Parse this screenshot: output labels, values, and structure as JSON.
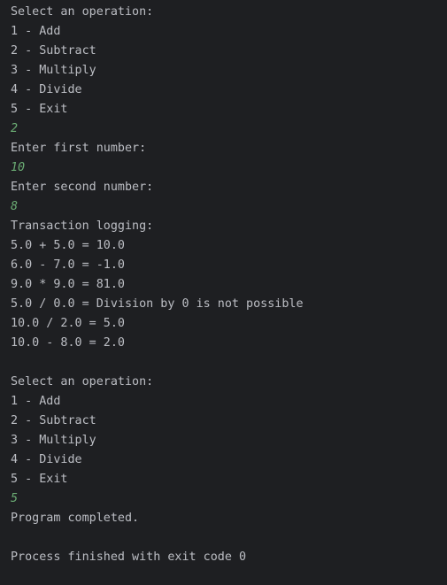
{
  "console": {
    "lines": [
      {
        "text": "Select an operation:",
        "kind": "output"
      },
      {
        "text": "1 - Add",
        "kind": "output"
      },
      {
        "text": "2 - Subtract",
        "kind": "output"
      },
      {
        "text": "3 - Multiply",
        "kind": "output"
      },
      {
        "text": "4 - Divide",
        "kind": "output"
      },
      {
        "text": "5 - Exit",
        "kind": "output"
      },
      {
        "text": "2",
        "kind": "input"
      },
      {
        "text": "Enter first number:",
        "kind": "output"
      },
      {
        "text": "10",
        "kind": "input"
      },
      {
        "text": "Enter second number:",
        "kind": "output"
      },
      {
        "text": "8",
        "kind": "input"
      },
      {
        "text": "Transaction logging:",
        "kind": "output"
      },
      {
        "text": "5.0 + 5.0 = 10.0",
        "kind": "output"
      },
      {
        "text": "6.0 - 7.0 = -1.0",
        "kind": "output"
      },
      {
        "text": "9.0 * 9.0 = 81.0",
        "kind": "output"
      },
      {
        "text": "5.0 / 0.0 = Division by 0 is not possible",
        "kind": "output"
      },
      {
        "text": "10.0 / 2.0 = 5.0",
        "kind": "output"
      },
      {
        "text": "10.0 - 8.0 = 2.0",
        "kind": "output"
      },
      {
        "text": "",
        "kind": "blank"
      },
      {
        "text": "Select an operation:",
        "kind": "output"
      },
      {
        "text": "1 - Add",
        "kind": "output"
      },
      {
        "text": "2 - Subtract",
        "kind": "output"
      },
      {
        "text": "3 - Multiply",
        "kind": "output"
      },
      {
        "text": "4 - Divide",
        "kind": "output"
      },
      {
        "text": "5 - Exit",
        "kind": "output"
      },
      {
        "text": "5",
        "kind": "input"
      },
      {
        "text": "Program completed.",
        "kind": "output"
      },
      {
        "text": "",
        "kind": "blank"
      },
      {
        "text": "Process finished with exit code 0",
        "kind": "output"
      }
    ]
  },
  "colors": {
    "background": "#1e1f22",
    "output_text": "#bcbec4",
    "user_input_text": "#6aab73"
  }
}
